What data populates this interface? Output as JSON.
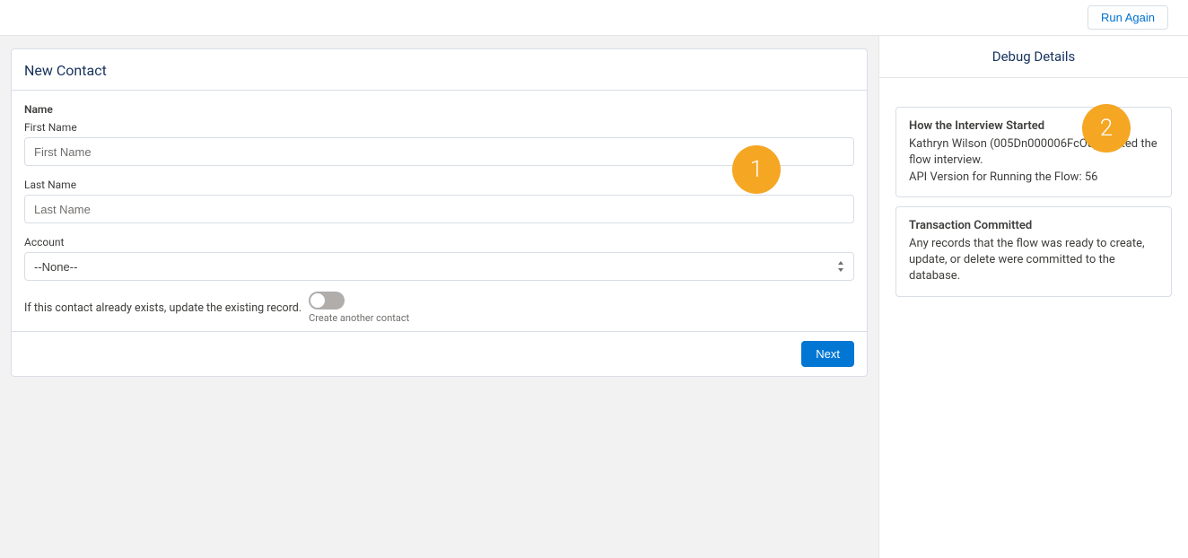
{
  "topbar": {
    "run_again_label": "Run Again"
  },
  "form": {
    "title": "New Contact",
    "section_label": "Name",
    "first_name_label": "First Name",
    "first_name_placeholder": "First Name",
    "last_name_label": "Last Name",
    "last_name_placeholder": "Last Name",
    "account_label": "Account",
    "account_selected": "--None--",
    "toggle_text": "If this contact already exists, update the existing record.",
    "toggle_sub": "Create another contact",
    "next_label": "Next"
  },
  "debug": {
    "header": "Debug Details",
    "cards": [
      {
        "title": "How the Interview Started",
        "body": "Kathryn Wilson (005Dn000006FcO8) started the flow interview.\nAPI Version for Running the Flow: 56"
      },
      {
        "title": "Transaction Committed",
        "body": "Any records that the flow was ready to create, update, or delete were committed to the database."
      }
    ]
  },
  "annotations": {
    "one": "1",
    "two": "2"
  }
}
